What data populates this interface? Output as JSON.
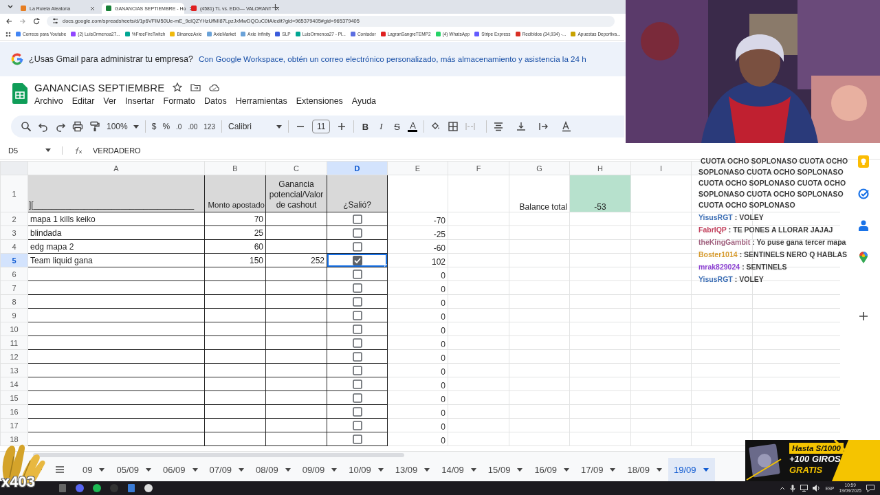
{
  "browser": {
    "tabs": [
      {
        "title": "La Ruleta Aleatoria",
        "selected": false
      },
      {
        "title": "GANANCIAS SEPTIEMBRE - Ho",
        "selected": true
      },
      {
        "title": "(4581) TL vs. EDG— VALORANT",
        "selected": false
      }
    ],
    "address": "docs.google.com/spreadsheets/d/1p6VFIM50Ue-mE_9clQZYHzUfMI87LpzJxMwDQCuC0tA/edit?gid=965379405#gid=965379405",
    "bookmarks": [
      {
        "label": "Correos para Youtube",
        "color": "#4285f4"
      },
      {
        "label": "(2) LuisOrmenoa27...",
        "color": "#9146ff"
      },
      {
        "label": "%FreeFireTwitch",
        "color": "#00a693"
      },
      {
        "label": "BinanceAxie",
        "color": "#f0b90b"
      },
      {
        "label": "AxieMarket",
        "color": "#6aa2d8"
      },
      {
        "label": "Axie Infinity",
        "color": "#6aa2d8"
      },
      {
        "label": "SLP",
        "color": "#3b5bdb"
      },
      {
        "label": "LuisOrmenoa27 - Pl...",
        "color": "#00a693"
      },
      {
        "label": "Contador",
        "color": "#5b6ee1"
      },
      {
        "label": "LagranSangreTEMP2",
        "color": "#e02020"
      },
      {
        "label": "(4) WhatsApp",
        "color": "#25d366"
      },
      {
        "label": "Stripe Express",
        "color": "#635bff"
      },
      {
        "label": "Recibidos (34,934) -...",
        "color": "#d93025"
      },
      {
        "label": "Apuestas Deportiva...",
        "color": "#c8a200"
      }
    ]
  },
  "banner": {
    "question": "¿Usas Gmail para administrar tu empresa?",
    "text": "Con Google Workspace, obtén un correo electrónico personalizado, más almacenamiento y asistencia la 24 h"
  },
  "document": {
    "title": "GANANCIAS SEPTIEMBRE",
    "menu": [
      "Archivo",
      "Editar",
      "Ver",
      "Insertar",
      "Formato",
      "Datos",
      "Herramientas",
      "Extensiones",
      "Ayuda"
    ]
  },
  "toolbar": {
    "zoom": "100%",
    "currency": "$",
    "percent": "%",
    "decrease_decimals": ".0",
    "increase_decimals": ".00",
    "number_format": "123",
    "font": "Calibri",
    "font_size": "11",
    "format_buttons": [
      {
        "label": "B",
        "kind": "bold"
      },
      {
        "label": "I",
        "kind": "italic"
      },
      {
        "label": "S",
        "kind": "strike"
      },
      {
        "label": "A",
        "kind": "color"
      }
    ]
  },
  "formula_bar": {
    "cell": "D5",
    "value": "VERDADERO"
  },
  "sheet": {
    "columns": [
      {
        "label": "A",
        "selected": false
      },
      {
        "label": "B",
        "selected": false
      },
      {
        "label": "C",
        "selected": false
      },
      {
        "label": "D",
        "selected": true
      },
      {
        "label": "E",
        "selected": false
      },
      {
        "label": "F",
        "selected": false
      },
      {
        "label": "G",
        "selected": false
      },
      {
        "label": "H",
        "selected": false
      },
      {
        "label": "I",
        "selected": false
      }
    ],
    "header_row": {
      "number": "1",
      "cells": [
        "][___________________________________",
        "Monto apostado",
        "Ganancia potencial/Valor de cashout",
        "¿Salió?"
      ]
    },
    "balance": {
      "label": "Balance total",
      "value": "-53"
    },
    "rows": [
      {
        "number": "2",
        "name": "mapa 1 kills keiko",
        "amount": "70",
        "checked": false,
        "result": "-70",
        "selected": false
      },
      {
        "number": "3",
        "name": "blindada",
        "amount": "25",
        "checked": false,
        "result": "-25",
        "selected": false
      },
      {
        "number": "4",
        "name": "edg mapa 2",
        "amount": "60",
        "checked": false,
        "result": "-60",
        "selected": false
      },
      {
        "number": "5",
        "name": "Team liquid gana",
        "amount": "150",
        "payout": "252",
        "checked": true,
        "result": "102",
        "selected": true
      },
      {
        "number": "6",
        "checked": false,
        "result": "0",
        "selected": false
      },
      {
        "number": "7",
        "checked": false,
        "result": "0",
        "selected": false
      },
      {
        "number": "8",
        "checked": false,
        "result": "0",
        "selected": false
      },
      {
        "number": "9",
        "checked": false,
        "result": "0",
        "selected": false
      },
      {
        "number": "10",
        "checked": false,
        "result": "0",
        "selected": false
      },
      {
        "number": "11",
        "checked": false,
        "result": "0",
        "selected": false
      },
      {
        "number": "12",
        "checked": false,
        "result": "0",
        "selected": false
      },
      {
        "number": "13",
        "checked": false,
        "result": "0",
        "selected": false
      },
      {
        "number": "14",
        "checked": false,
        "result": "0",
        "selected": false
      },
      {
        "number": "15",
        "checked": false,
        "result": "0",
        "selected": false
      },
      {
        "number": "16",
        "checked": false,
        "result": "0",
        "selected": false
      },
      {
        "number": "17",
        "checked": false,
        "result": "0",
        "selected": false
      },
      {
        "number": "18",
        "checked": false,
        "result": "0",
        "selected": false
      }
    ]
  },
  "sheet_tabs": [
    {
      "label": "09",
      "selected": false
    },
    {
      "label": "05/09",
      "selected": false
    },
    {
      "label": "06/09",
      "selected": false
    },
    {
      "label": "07/09",
      "selected": false
    },
    {
      "label": "08/09",
      "selected": false
    },
    {
      "label": "09/09",
      "selected": false
    },
    {
      "label": "10/09",
      "selected": false
    },
    {
      "label": "13/09",
      "selected": false
    },
    {
      "label": "14/09",
      "selected": false
    },
    {
      "label": "15/09",
      "selected": false
    },
    {
      "label": "16/09",
      "selected": false
    },
    {
      "label": "17/09",
      "selected": false
    },
    {
      "label": "18/09",
      "selected": false
    },
    {
      "label": "19/09",
      "selected": true
    }
  ],
  "chat": [
    {
      "text": "CUOTA OCHO SOPLONASO CUOTA OCHO SOPLONASO CUOTA OCHO SOPLONASO CUOTA OCHO SOPLONASO CUOTA OCHO SOPLONASO CUOTA OCHO SOPLONASO CUOTA OCHO SOPLONASO"
    },
    {
      "user": "YisusRGT",
      "color": "#3d6fb5",
      "text": ": VOLEY"
    },
    {
      "user": "FabrIQP",
      "color": "#c2405c",
      "text": ": TE PONES A LLORAR JAJAJ"
    },
    {
      "user": "theKingGambit",
      "color": "#a0607e",
      "text": ": Yo puse gana tercer mapa"
    },
    {
      "user": "Boster1014",
      "color": "#d69a2d",
      "text": ": SENTINELS NERO Q HABLAS"
    },
    {
      "user": "mrak829024",
      "color": "#8a3fd0",
      "text": ": SENTINELS"
    },
    {
      "user": "YisusRGT",
      "color": "#3d6fb5",
      "text": ": VOLEY"
    }
  ],
  "ad": {
    "lines": [
      "Hasta S/1000",
      "+100 GIROS",
      "GRATIS"
    ]
  },
  "clap_count": "x403",
  "taskbar": {
    "language": "ESP",
    "time": "10:59",
    "date": "19/09/2025"
  }
}
